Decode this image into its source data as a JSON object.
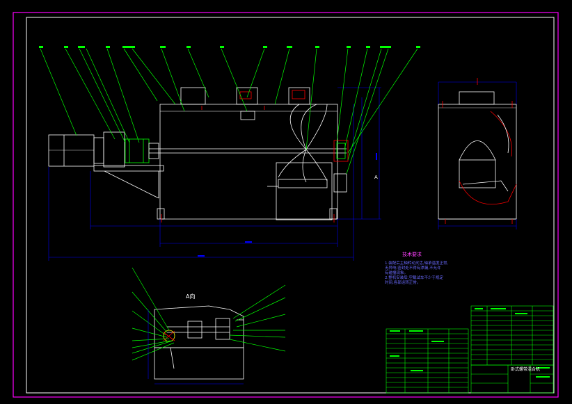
{
  "drawing": {
    "view_label": "A向",
    "section_mark": "A",
    "notes": {
      "title": "技术要求",
      "body": "1.装配后主轴转动灵活,轴承温度正常,\n  无异响,密封处不得有渗漏,不允许\n  有碰撞现象。\n2.整机安装后,空载试车不少于规定\n  时间,各部运转正常。"
    },
    "title_block": {
      "name": "卧式螺带混合机"
    }
  },
  "colors": {
    "background": "#000000",
    "frame_outer": "#ff00ff",
    "frame_inner": "#ffffff",
    "leader": "#00ff00",
    "dimension": "#0000ff",
    "table_lines": "#00ff00",
    "red_accent": "#ff0000"
  }
}
